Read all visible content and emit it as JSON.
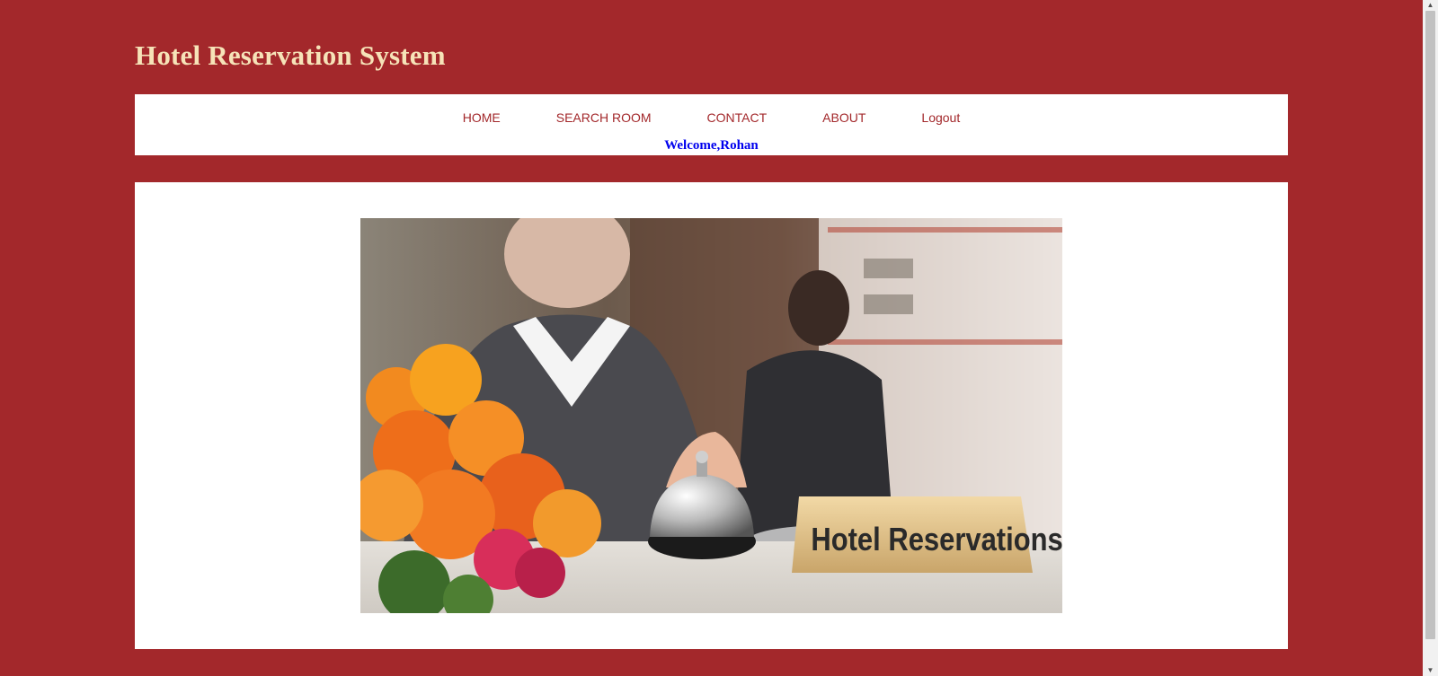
{
  "site": {
    "title": "Hotel Reservation System"
  },
  "nav": {
    "items": [
      {
        "label": "HOME"
      },
      {
        "label": "SEARCH ROOM"
      },
      {
        "label": "CONTACT"
      },
      {
        "label": "ABOUT"
      },
      {
        "label": "Logout"
      }
    ],
    "welcome": "Welcome,Rohan"
  },
  "hero": {
    "sign_text": "Hotel Reservations"
  },
  "colors": {
    "background": "#a3282b",
    "title": "#f6e3b8",
    "nav_link": "#a3282b",
    "welcome": "#0000ee"
  },
  "icons": {
    "scroll_up": "triangle-up-icon",
    "scroll_down": "triangle-down-icon"
  }
}
